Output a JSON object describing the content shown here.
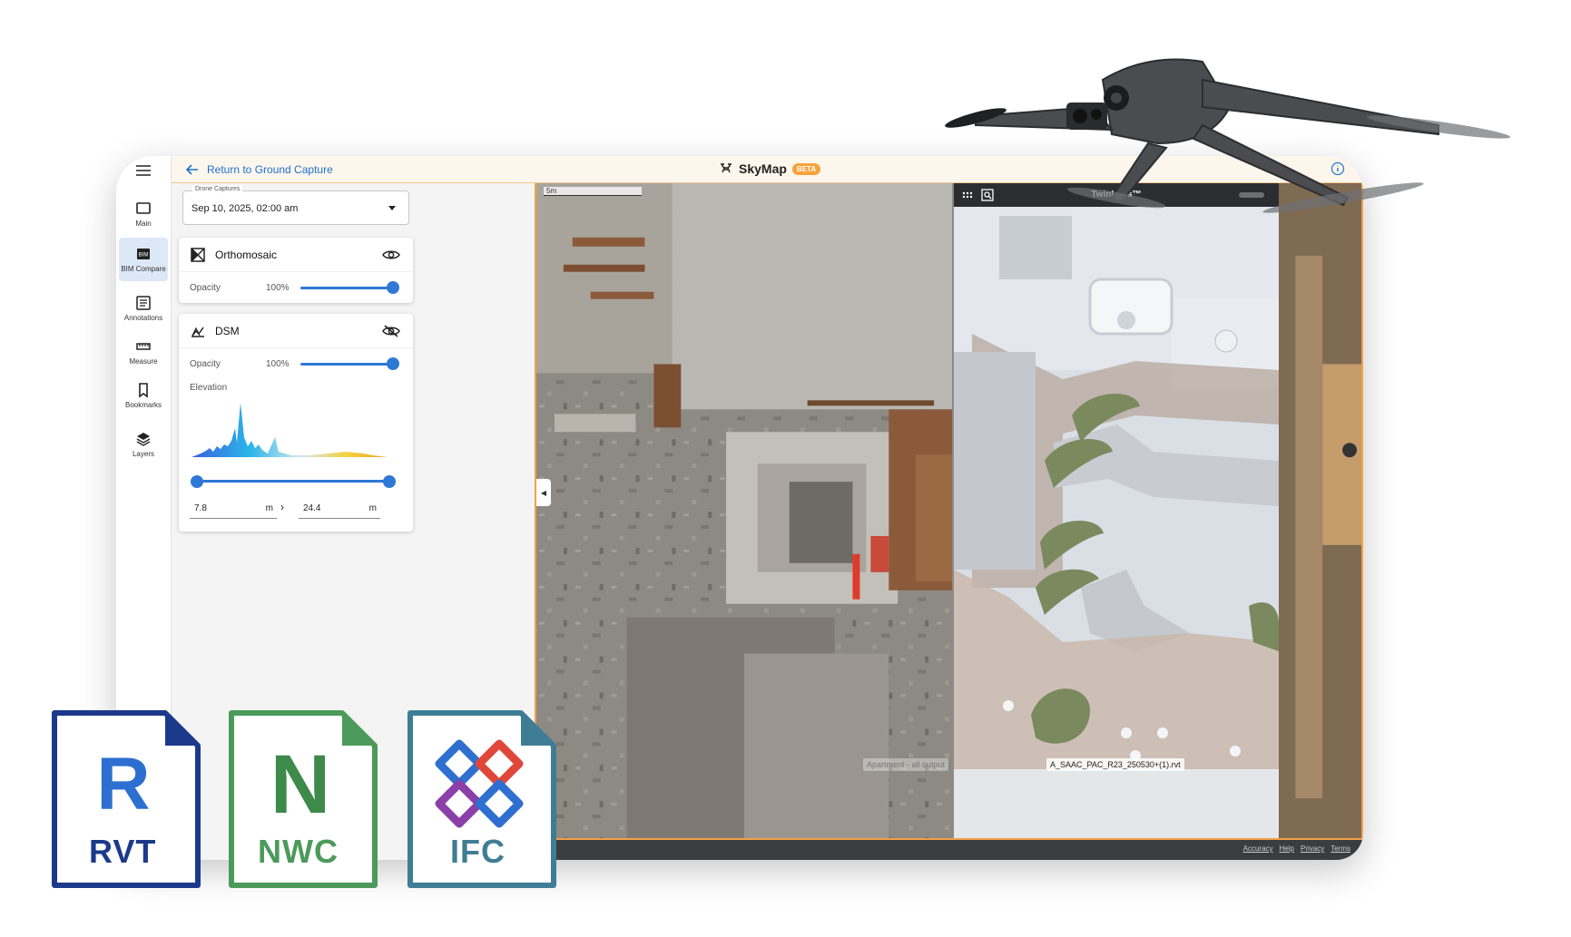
{
  "header": {
    "back_label": "Return to Ground Capture",
    "app_name": "SkyMap",
    "beta_label": "BETA"
  },
  "rail": {
    "items": [
      {
        "label": "Main",
        "icon": "square-icon"
      },
      {
        "label": "BIM Compare",
        "icon": "bim-icon"
      },
      {
        "label": "Annotations",
        "icon": "list-icon"
      },
      {
        "label": "Measure",
        "icon": "ruler-icon"
      },
      {
        "label": "Bookmarks",
        "icon": "bookmark-icon"
      },
      {
        "label": "Layers",
        "icon": "layers-icon"
      }
    ],
    "active": "BIM Compare"
  },
  "capture": {
    "label": "Drone Captures",
    "value": "Sep 10, 2025, 02:00 am"
  },
  "layers": {
    "orthomosaic": {
      "title": "Orthomosaic",
      "opacity_label": "Opacity",
      "opacity_value": "100%",
      "opacity": 1.0,
      "visible": true
    },
    "dsm": {
      "title": "DSM",
      "opacity_label": "Opacity",
      "opacity_value": "100%",
      "opacity": 1.0,
      "visible": false,
      "elevation_label": "Elevation",
      "elevation_min": "7.8",
      "elevation_max": "24.4",
      "unit": "m",
      "separator": "›"
    }
  },
  "map": {
    "scale_label": "5m",
    "twinlens_title": "TwinLens™",
    "left_model_label": "Apartment - all output",
    "right_model_label": "A_SAAC_PAC_R23_250530+(1).rvt"
  },
  "footer": {
    "links": [
      "Accuracy",
      "Help",
      "Privacy",
      "Terms"
    ]
  },
  "badges": [
    {
      "letter": "R",
      "text": "RVT",
      "color": "#1d3a8a"
    },
    {
      "letter": "N",
      "text": "NWC",
      "color": "#4c9a5b"
    },
    {
      "letter": "",
      "text": "IFC",
      "color": "#3f7d96"
    }
  ],
  "colors": {
    "accent_blue": "#2e78d6",
    "map_border": "#f2a148",
    "beta": "#f7a23b"
  }
}
